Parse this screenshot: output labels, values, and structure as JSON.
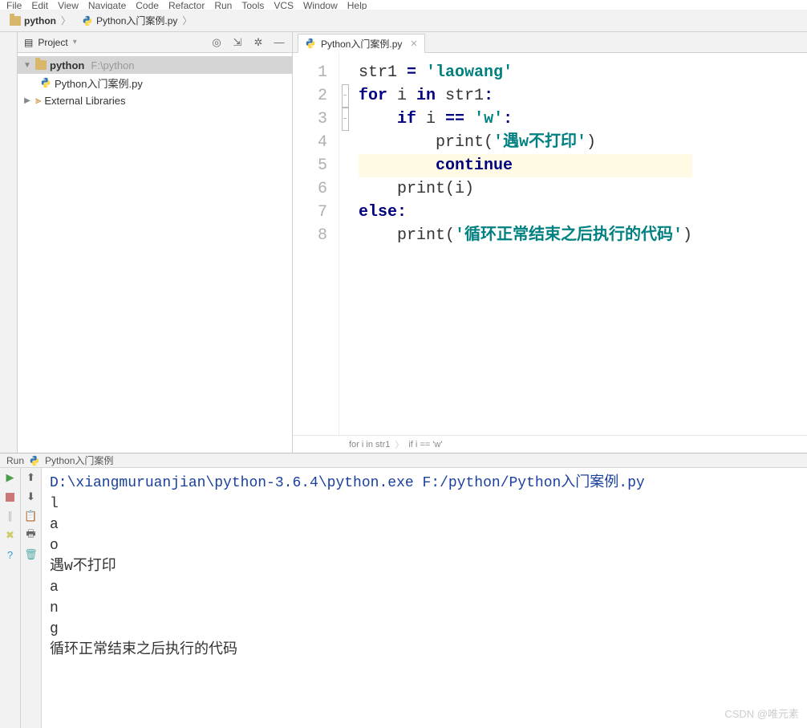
{
  "menu": [
    "File",
    "Edit",
    "View",
    "Navigate",
    "Code",
    "Refactor",
    "Run",
    "Tools",
    "VCS",
    "Window",
    "Help"
  ],
  "breadcrumb": {
    "root": "python",
    "file": "Python入门案例.py"
  },
  "project_panel": {
    "title": "Project",
    "root_name": "python",
    "root_path": "F:\\python",
    "file": "Python入门案例.py",
    "libs": "External Libraries"
  },
  "editor": {
    "tab": "Python入门案例.py",
    "lines": [
      [
        {
          "t": "str1 ",
          "c": ""
        },
        {
          "t": "=",
          "c": "kw"
        },
        {
          "t": " ",
          "c": ""
        },
        {
          "t": "'laowang'",
          "c": "str"
        }
      ],
      [
        {
          "t": "for",
          "c": "kw"
        },
        {
          "t": " i ",
          "c": ""
        },
        {
          "t": "in",
          "c": "kw"
        },
        {
          "t": " str1",
          "c": ""
        },
        {
          "t": ":",
          "c": "kw"
        }
      ],
      [
        {
          "t": "    ",
          "c": ""
        },
        {
          "t": "if",
          "c": "kw"
        },
        {
          "t": " i ",
          "c": ""
        },
        {
          "t": "==",
          "c": "kw"
        },
        {
          "t": " ",
          "c": ""
        },
        {
          "t": "'w'",
          "c": "str"
        },
        {
          "t": ":",
          "c": "kw"
        }
      ],
      [
        {
          "t": "        print(",
          "c": ""
        },
        {
          "t": "'遇w不打印'",
          "c": "str"
        },
        {
          "t": ")",
          "c": ""
        }
      ],
      [
        {
          "t": "        ",
          "c": ""
        },
        {
          "t": "continue",
          "c": "kw"
        }
      ],
      [
        {
          "t": "    print(i)",
          "c": ""
        }
      ],
      [
        {
          "t": "else",
          "c": "kw"
        },
        {
          "t": ":",
          "c": "kw"
        }
      ],
      [
        {
          "t": "    print(",
          "c": ""
        },
        {
          "t": "'循环正常结束之后执行的代码'",
          "c": "str"
        },
        {
          "t": ")",
          "c": ""
        }
      ]
    ],
    "highlight_line": 5,
    "crumbs": [
      "for i in str1",
      "if i == 'w'"
    ]
  },
  "run": {
    "title": "Run",
    "config": "Python入门案例",
    "command": "D:\\xiangmuruanjian\\python-3.6.4\\python.exe F:/python/Python入门案例.py",
    "output": [
      "l",
      "a",
      "o",
      "遇w不打印",
      "a",
      "n",
      "g",
      "循环正常结束之后执行的代码"
    ]
  },
  "watermark": "CSDN @唯元素"
}
